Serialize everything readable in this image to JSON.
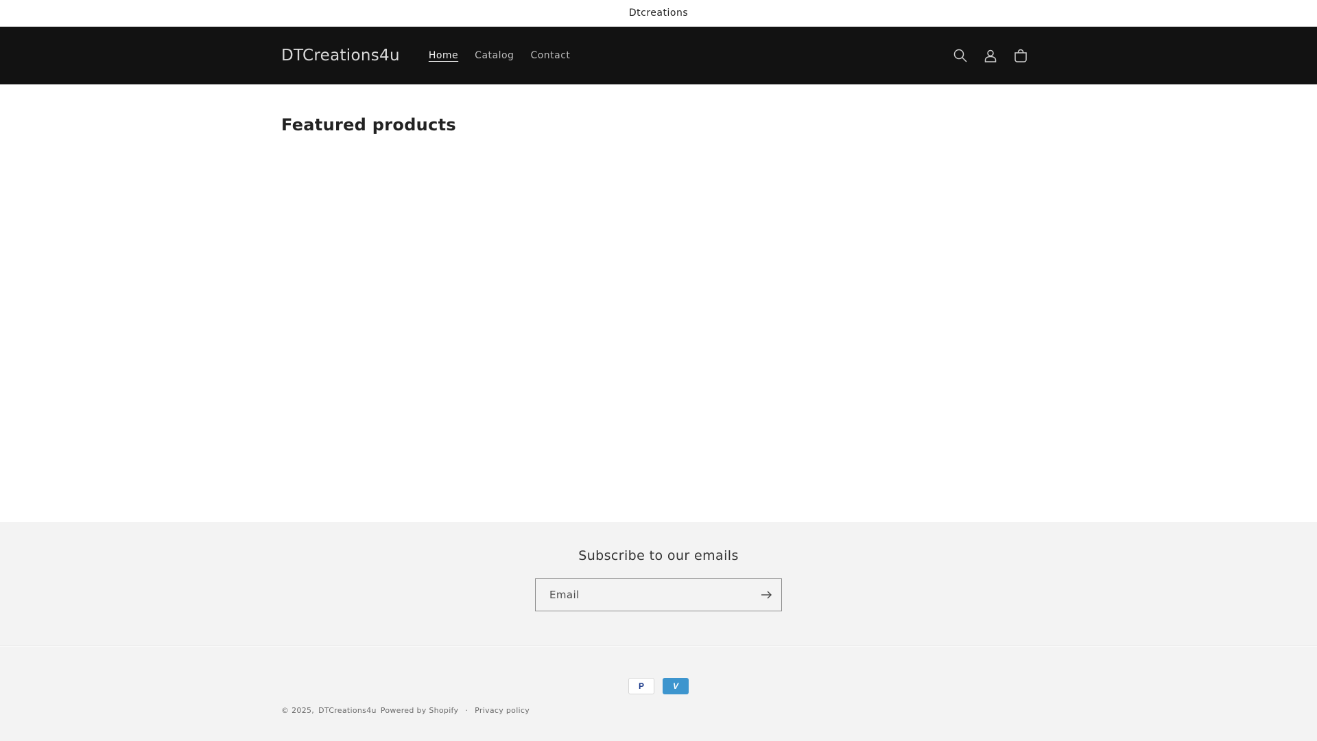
{
  "announcement": {
    "text": "Dtcreations"
  },
  "header": {
    "logo": "DTCreations4u",
    "nav": [
      {
        "label": "Home",
        "active": true
      },
      {
        "label": "Catalog",
        "active": false
      },
      {
        "label": "Contact",
        "active": false
      }
    ],
    "icons": [
      "search-icon",
      "account-icon",
      "cart-icon"
    ]
  },
  "main": {
    "featured_title": "Featured products"
  },
  "newsletter": {
    "heading": "Subscribe to our emails",
    "email_placeholder": "Email",
    "submit_icon": "arrow-right-icon"
  },
  "footer": {
    "payment_methods": [
      "PayPal",
      "Venmo"
    ],
    "copyright_prefix": "© 2025,",
    "store_link": "DTCreations4u",
    "powered_by": "Powered by Shopify",
    "privacy_policy": "Privacy policy",
    "separator": "·"
  },
  "colors": {
    "header_bg": "#121212",
    "page_bg": "#ffffff",
    "footer_bg": "#f3f3f3",
    "venmo_blue": "#3d95ce"
  }
}
